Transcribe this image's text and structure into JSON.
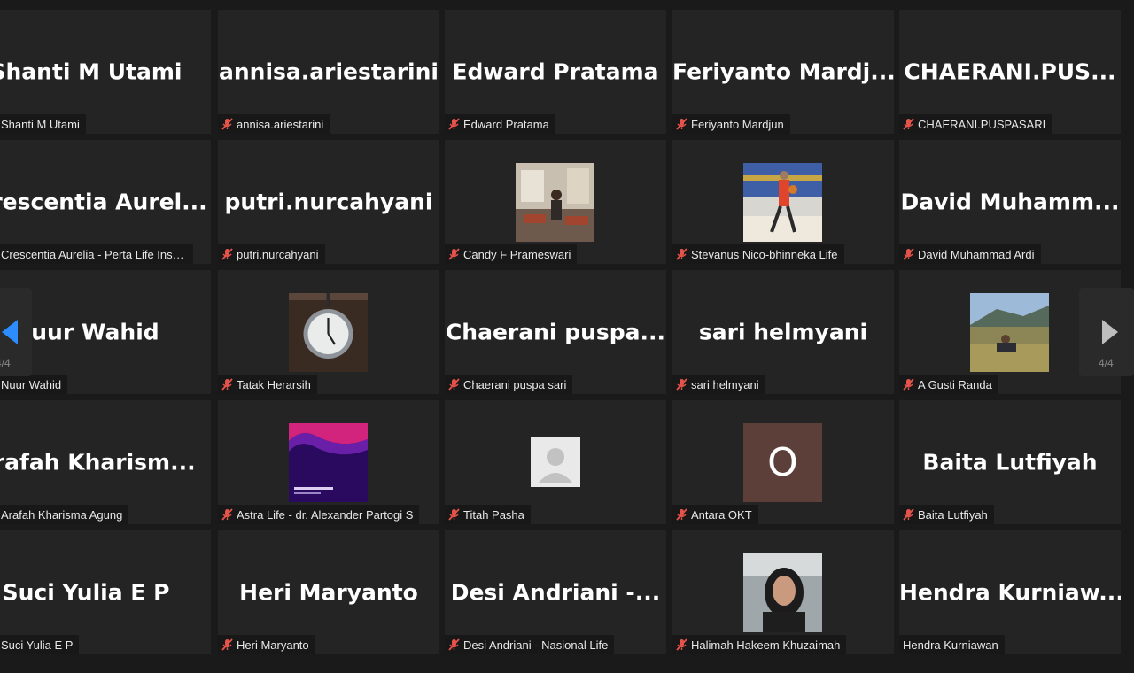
{
  "pagination": {
    "prev_label": "4/4",
    "next_label": "4/4"
  },
  "colors": {
    "mic_muted": "#e5534b",
    "nav_prev_arrow": "#2d8cff",
    "nav_next_arrow": "#bdbdbd"
  },
  "participants": [
    {
      "display": "Shanti M Utami",
      "label": "Shanti M Utami",
      "muted": true,
      "cut": true
    },
    {
      "display": "annisa.ariestarini",
      "label": "annisa.ariestarini",
      "muted": true
    },
    {
      "display": "Edward Pratama",
      "label": "Edward Pratama",
      "muted": true
    },
    {
      "display": "Feriyanto  Mardj...",
      "label": "Feriyanto Mardjun",
      "muted": true
    },
    {
      "display": "CHAERANI.PUS...",
      "label": "CHAERANI.PUSPASARI",
      "muted": true
    },
    {
      "display": "Crescentia  Aurel...",
      "label": "Crescentia Aurelia - Perta Life Insur...",
      "muted": true,
      "cut": true
    },
    {
      "display": "putri.nurcahyani",
      "label": "putri.nurcahyani",
      "muted": true
    },
    {
      "avatar": "photo-cafe",
      "label": "Candy F Prameswari",
      "muted": true
    },
    {
      "avatar": "photo-basketball",
      "label": "Stevanus Nico-bhinneka Life",
      "muted": true
    },
    {
      "display": "David  Muhamm...",
      "label": "David Muhammad Ardi",
      "muted": true
    },
    {
      "display": "Nuur Wahid",
      "label": "Nuur Wahid",
      "muted": true,
      "cut": true
    },
    {
      "avatar": "photo-clock",
      "label": "Tatak Herarsih",
      "muted": true
    },
    {
      "display": "Chaerani  puspa...",
      "label": "Chaerani puspa sari",
      "muted": true
    },
    {
      "display": "sari helmyani",
      "label": "sari helmyani",
      "muted": true
    },
    {
      "avatar": "photo-landscape",
      "label": "A Gusti Randa",
      "muted": true
    },
    {
      "display": "Arafah  Kharism...",
      "label": "Arafah Kharisma Agung",
      "muted": true,
      "cut": true
    },
    {
      "avatar": "photo-poster",
      "label": "Astra Life - dr. Alexander Partogi S",
      "muted": true
    },
    {
      "avatar": "default-user",
      "label": "Titah Pasha",
      "muted": true
    },
    {
      "avatar": "letter",
      "letter": "O",
      "letter_color": "#5c3f38",
      "label": "Antara OKT",
      "muted": true
    },
    {
      "display": "Baita Lutfiyah",
      "label": "Baita Lutfiyah",
      "muted": true
    },
    {
      "display": "Suci Yulia E P",
      "label": "Suci Yulia E P",
      "muted": true,
      "cut": true
    },
    {
      "display": "Heri Maryanto",
      "label": "Heri Maryanto",
      "muted": true
    },
    {
      "display": "Desi Andriani  -...",
      "label": "Desi Andriani - Nasional Life",
      "muted": true
    },
    {
      "avatar": "photo-selfie",
      "label": "Halimah Hakeem Khuzaimah",
      "muted": true
    },
    {
      "display": "Hendra  Kurniaw...",
      "label": "Hendra Kurniawan",
      "muted": false
    }
  ]
}
